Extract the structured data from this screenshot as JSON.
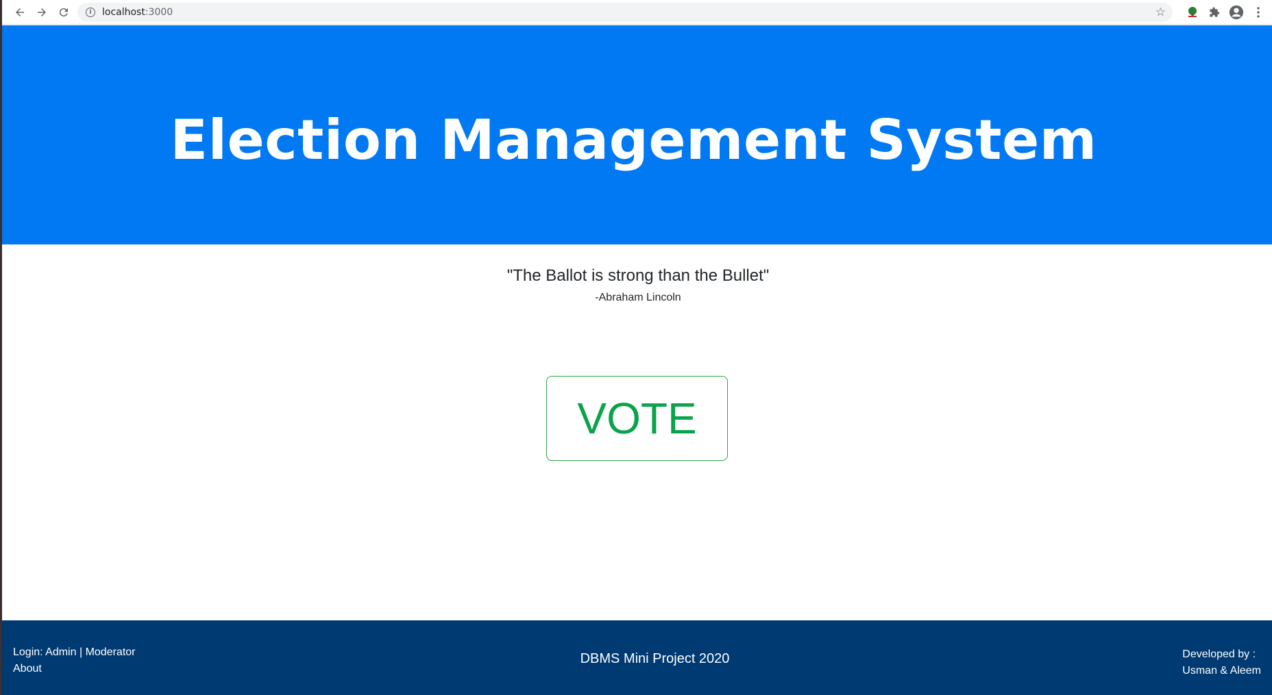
{
  "browser": {
    "url_host": "localhost",
    "url_port": ":3000",
    "back_icon": "arrow-left-icon",
    "forward_icon": "arrow-right-icon",
    "reload_icon": "reload-icon",
    "info_icon": "info-icon",
    "bookmark_icon": "star-icon",
    "extensions": [
      "tree-extension-icon",
      "puzzle-icon",
      "profile-icon",
      "more-vert-icon"
    ]
  },
  "hero": {
    "title": "Election Management System",
    "background": "#0079f2"
  },
  "quote": {
    "text": "\"The Ballot is strong than the Bullet\"",
    "author": "-Abraham Lincoln"
  },
  "vote": {
    "label": "VOTE",
    "color": "#0aa34a"
  },
  "footer": {
    "background": "#003a72",
    "login_prefix": "Login: ",
    "admin_link": "Admin",
    "separator": " | ",
    "moderator_link": "Moderator",
    "about_link": "About",
    "project": "DBMS Mini Project 2020",
    "developed_by_label": "Developed by :",
    "developers": "Usman & Aleem"
  }
}
